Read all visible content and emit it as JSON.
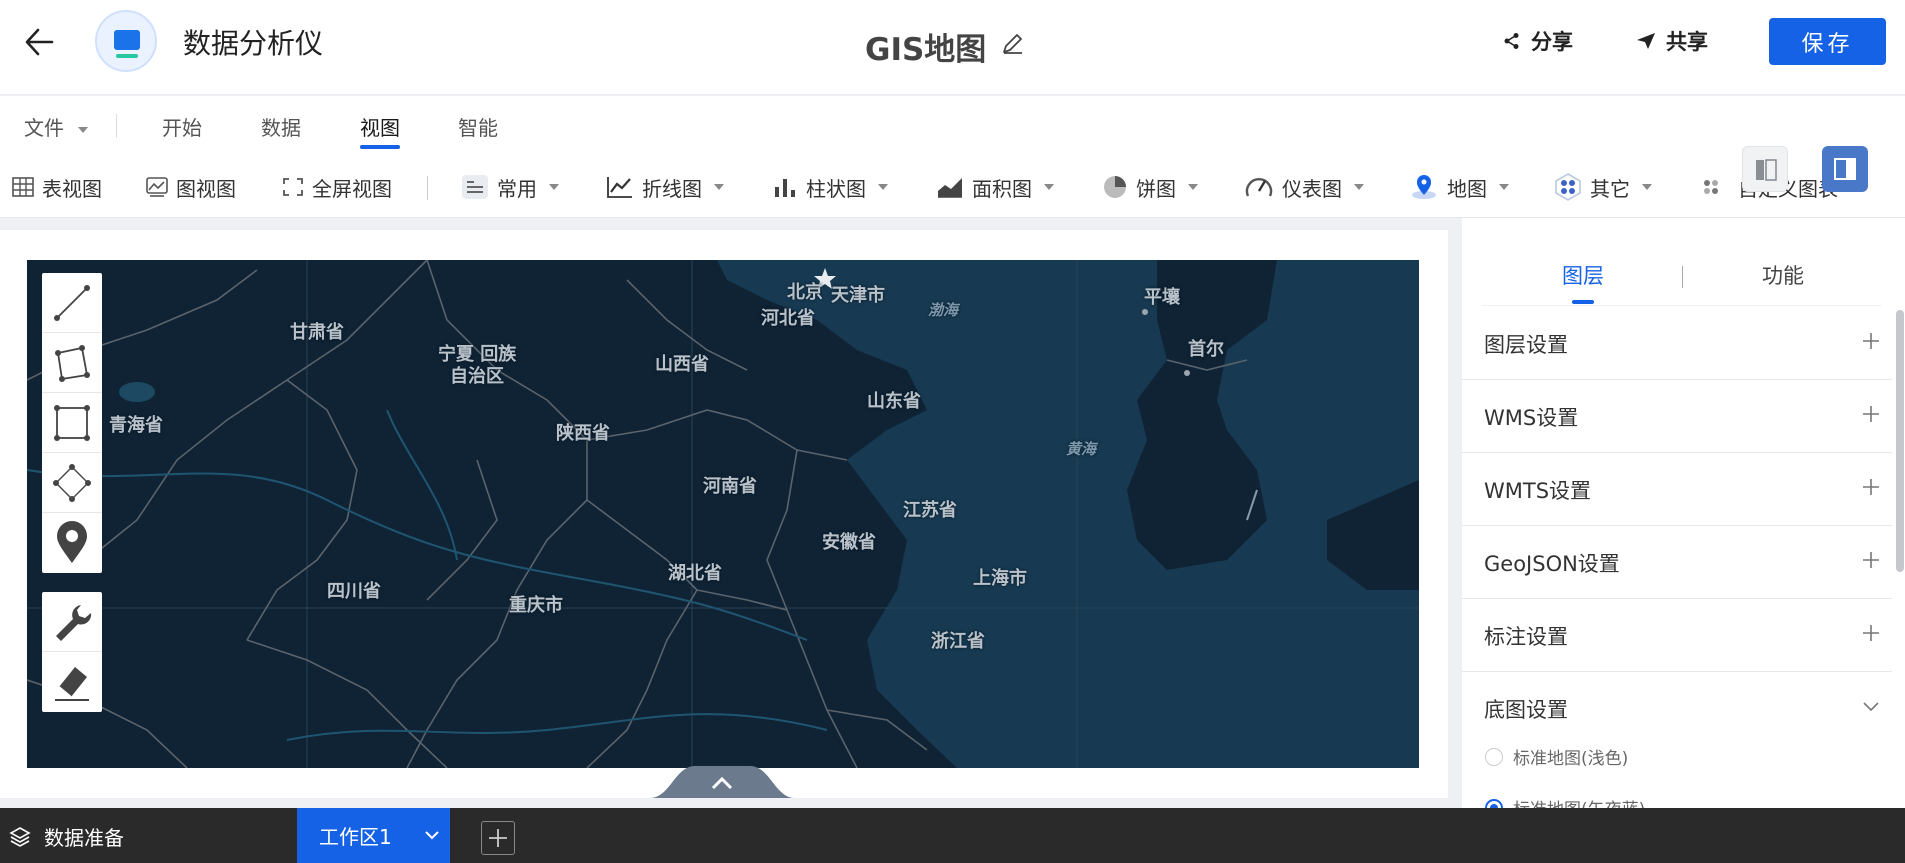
{
  "header": {
    "app_name": "数据分析仪",
    "doc_title": "GIS地图",
    "share_label": "分享",
    "collab_label": "共享",
    "save_label": "保存",
    "icons": {
      "back": "arrow-left-icon",
      "logo": "chart-monitor-icon",
      "edit": "pencil-icon",
      "share": "share-nodes-icon",
      "collab": "paper-plane-icon"
    }
  },
  "menu": {
    "tabs": [
      {
        "label": "文件",
        "has_dropdown": true
      },
      {
        "label": "开始"
      },
      {
        "label": "数据"
      },
      {
        "label": "视图",
        "active": true
      },
      {
        "label": "智能"
      }
    ]
  },
  "toolbar": {
    "view_items": [
      {
        "label": "表视图",
        "icon": "table-grid-icon"
      },
      {
        "label": "图视图",
        "icon": "chart-image-icon"
      },
      {
        "label": "全屏视图",
        "icon": "fullscreen-icon"
      }
    ],
    "chart_items": [
      {
        "label": "常用",
        "icon": "common-chart-icon"
      },
      {
        "label": "折线图",
        "icon": "line-chart-icon"
      },
      {
        "label": "柱状图",
        "icon": "bar-chart-icon"
      },
      {
        "label": "面积图",
        "icon": "area-chart-icon"
      },
      {
        "label": "饼图",
        "icon": "pie-chart-icon"
      },
      {
        "label": "仪表图",
        "icon": "gauge-icon"
      },
      {
        "label": "地图",
        "icon": "map-pin-icon"
      },
      {
        "label": "其它",
        "icon": "hexagon-dots-icon"
      },
      {
        "label": "自定义图表",
        "icon": "custom-dots-icon"
      }
    ]
  },
  "map": {
    "provinces": [
      "甘肃省",
      "宁夏 回族",
      "自治区",
      "青海省",
      "山西省",
      "河北省",
      "北京",
      "天津市",
      "陕西省",
      "山东省",
      "河南省",
      "江苏省",
      "安徽省",
      "四川省",
      "湖北省",
      "重庆市",
      "上海市",
      "浙江省",
      "平壤",
      "首尔"
    ],
    "seas": [
      "渤海",
      "黄海"
    ],
    "draw_tools": [
      "line-draw-icon",
      "polygon-draw-icon",
      "rectangle-draw-icon",
      "circle-draw-icon",
      "marker-pin-icon"
    ],
    "edit_tools": [
      "wrench-icon",
      "eraser-icon"
    ],
    "colors": {
      "land": "#0f2335",
      "sea": "#173a52",
      "border": "#56606a",
      "river": "#1f5570"
    }
  },
  "panel": {
    "tabs": [
      {
        "label": "图层",
        "active": true
      },
      {
        "label": "功能"
      }
    ],
    "sections": [
      {
        "label": "图层设置",
        "state": "collapsed"
      },
      {
        "label": "WMS设置",
        "state": "collapsed"
      },
      {
        "label": "WMTS设置",
        "state": "collapsed"
      },
      {
        "label": "GeoJSON设置",
        "state": "collapsed"
      },
      {
        "label": "标注设置",
        "state": "collapsed"
      },
      {
        "label": "底图设置",
        "state": "expanded"
      }
    ],
    "basemap_options": [
      {
        "label": "标准地图(浅色)",
        "selected": false
      },
      {
        "label": "标准地图(午夜蓝)",
        "selected": true
      }
    ]
  },
  "bottom": {
    "data_prep_label": "数据准备",
    "workspace_label": "工作区1",
    "icons": {
      "data_prep": "layers-icon",
      "workspace": "chevron-down-icon",
      "add": "plus-icon"
    }
  },
  "accent_color": "#1662e6"
}
